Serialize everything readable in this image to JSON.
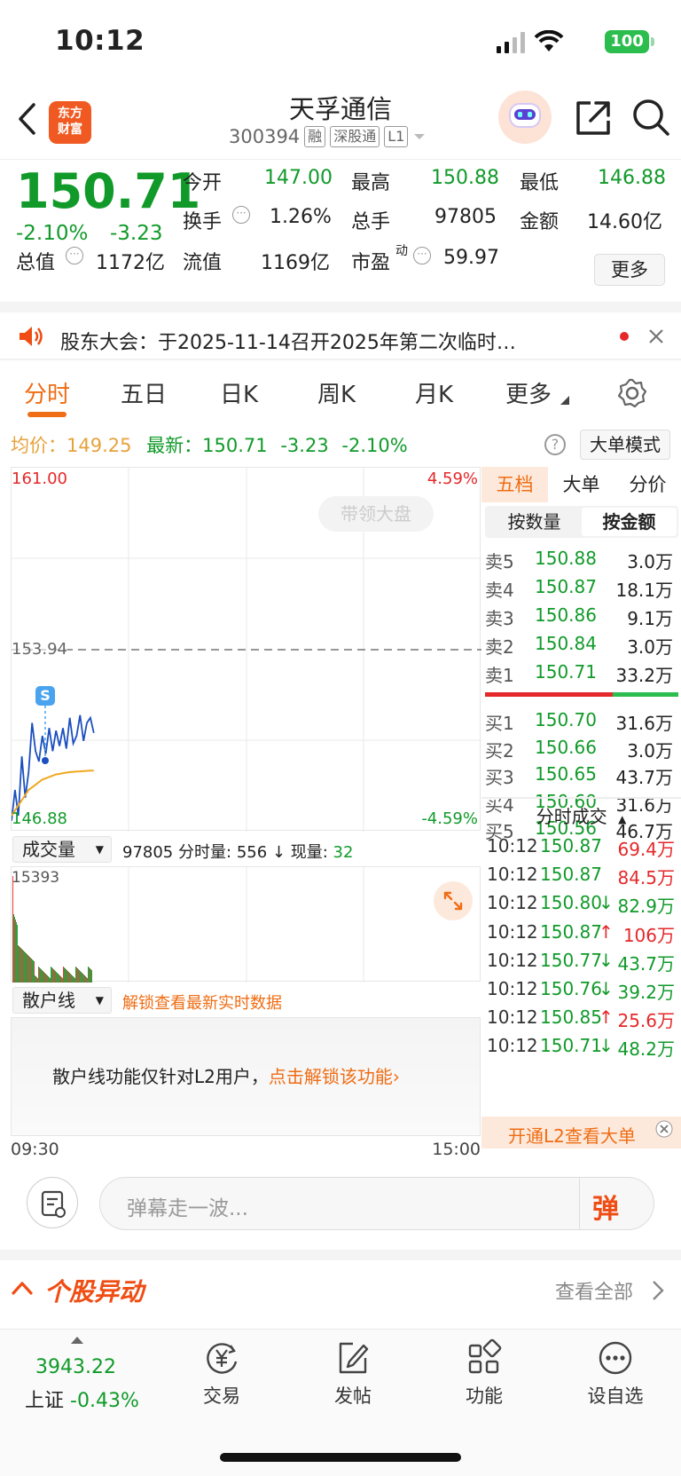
{
  "status": {
    "time": "10:12",
    "battery": "100"
  },
  "nav": {
    "logo_line1": "东方",
    "logo_line2": "财富",
    "stock_name": "天孚通信",
    "stock_code": "300394",
    "tags": [
      "融",
      "深股通",
      "L1"
    ]
  },
  "quote": {
    "price": "150.71",
    "change_pct": "-2.10%",
    "change": "-3.23",
    "rows": [
      {
        "l1": "今开",
        "v1": "147.00",
        "l2": "最高",
        "v2": "150.88",
        "l3": "最低",
        "v3": "146.88"
      },
      {
        "l1": "换手",
        "v1": "1.26%",
        "l2": "总手",
        "v2": "97805",
        "l3": "金额",
        "v3": "14.60亿"
      },
      {
        "l1": "总值",
        "v1": "1172亿",
        "l2": "流值",
        "v2": "1169亿",
        "l3": "市盈",
        "l3_sup": "动",
        "v3": "59.97"
      }
    ],
    "more": "更多"
  },
  "banner": {
    "text": "股东大会：于2025-11-14召开2025年第二次临时…"
  },
  "tabs": [
    "分时",
    "五日",
    "日K",
    "周K",
    "月K",
    "更多"
  ],
  "info_line": {
    "avg_label": "均价：",
    "avg_value": "149.25",
    "last_label": "最新：",
    "last_value": "150.71",
    "chg": "-3.23",
    "chg_pct": "-2.10%",
    "help": "?",
    "big_order_mode": "大单模式"
  },
  "chart": {
    "y_max": "161.00",
    "y_max_pct": "4.59%",
    "y_prev": "153.94",
    "y_min": "146.88",
    "y_min_pct": "-4.59%",
    "watermark": "带领大盘",
    "marker": "S"
  },
  "chart_data": {
    "type": "line",
    "ylim": [
      146.88,
      161.0
    ],
    "prev_close": 153.94,
    "series": [
      {
        "values": [
          147.3,
          148.5,
          147.5,
          149.8,
          148.2,
          149.2,
          151.1,
          150.0,
          149.6,
          150.6,
          149.9,
          150.9,
          150.0,
          150.8,
          150.2,
          150.9,
          150.1,
          151.3,
          150.3,
          150.6,
          151.4,
          150.4,
          151.1,
          151.3,
          150.71
        ]
      },
      {
        "values": [
          147.5,
          147.7,
          147.9,
          148.1,
          148.3,
          148.5,
          148.6,
          148.7,
          148.8,
          148.9,
          148.95,
          149.0,
          149.05,
          149.1,
          149.12,
          149.15,
          149.17,
          149.19,
          149.2,
          149.21,
          149.22,
          149.23,
          149.24,
          149.25,
          149.25
        ]
      }
    ]
  },
  "volume": {
    "selector": "成交量",
    "total": "97805",
    "period_label": "分时量:",
    "period_value": "556",
    "cur_label": "现量:",
    "cur_value": "32",
    "max_label": "15393"
  },
  "scatter": {
    "selector": "散户线",
    "unlock_hint": "解锁查看最新实时数据",
    "lock_text": "散户线功能仅针对L2用户，",
    "lock_link": "点击解锁该功能›"
  },
  "time_axis": {
    "start": "09:30",
    "end": "15:00"
  },
  "orderbook": {
    "tabs": [
      "五档",
      "大单",
      "分价"
    ],
    "subtabs": [
      "按数量",
      "按金额"
    ],
    "asks": [
      {
        "label": "卖5",
        "price": "150.88",
        "amount": "3.0万"
      },
      {
        "label": "卖4",
        "price": "150.87",
        "amount": "18.1万"
      },
      {
        "label": "卖3",
        "price": "150.86",
        "amount": "9.1万"
      },
      {
        "label": "卖2",
        "price": "150.84",
        "amount": "3.0万"
      },
      {
        "label": "卖1",
        "price": "150.71",
        "amount": "33.2万"
      }
    ],
    "bids": [
      {
        "label": "买1",
        "price": "150.70",
        "amount": "31.6万"
      },
      {
        "label": "买2",
        "price": "150.66",
        "amount": "3.0万"
      },
      {
        "label": "买3",
        "price": "150.65",
        "amount": "43.7万"
      },
      {
        "label": "买4",
        "price": "150.60",
        "amount": "31.6万"
      },
      {
        "label": "买5",
        "price": "150.56",
        "amount": "46.7万"
      }
    ],
    "ticks_title": "分时成交",
    "ticks": [
      {
        "t": "10:12",
        "p": "150.87",
        "d": "",
        "a": "69.4万",
        "c": "#e5282a"
      },
      {
        "t": "10:12",
        "p": "150.87",
        "d": "",
        "a": "84.5万",
        "c": "#e5282a"
      },
      {
        "t": "10:12",
        "p": "150.80",
        "d": "↓",
        "a": "82.9万",
        "c": "#119a2a"
      },
      {
        "t": "10:12",
        "p": "150.87",
        "d": "↑",
        "a": "106万",
        "c": "#e5282a"
      },
      {
        "t": "10:12",
        "p": "150.77",
        "d": "↓",
        "a": "43.7万",
        "c": "#119a2a"
      },
      {
        "t": "10:12",
        "p": "150.76",
        "d": "↓",
        "a": "39.2万",
        "c": "#119a2a"
      },
      {
        "t": "10:12",
        "p": "150.85",
        "d": "↑",
        "a": "25.6万",
        "c": "#e5282a"
      },
      {
        "t": "10:12",
        "p": "150.71",
        "d": "↓",
        "a": "48.2万",
        "c": "#119a2a"
      }
    ],
    "l2_promo": "开通L2查看大单"
  },
  "input_bar": {
    "placeholder": "弹幕走一波...",
    "send": "弹"
  },
  "section": {
    "title": "个股异动",
    "see_all": "查看全部"
  },
  "tabbar": {
    "index_value": "3943.22",
    "index_name": "上证",
    "index_pct": "-0.43%",
    "items": [
      "交易",
      "发帖",
      "功能",
      "设自选"
    ]
  },
  "colors": {
    "up": "#e5282a",
    "down": "#119a2a",
    "accent": "#ef6d14"
  }
}
